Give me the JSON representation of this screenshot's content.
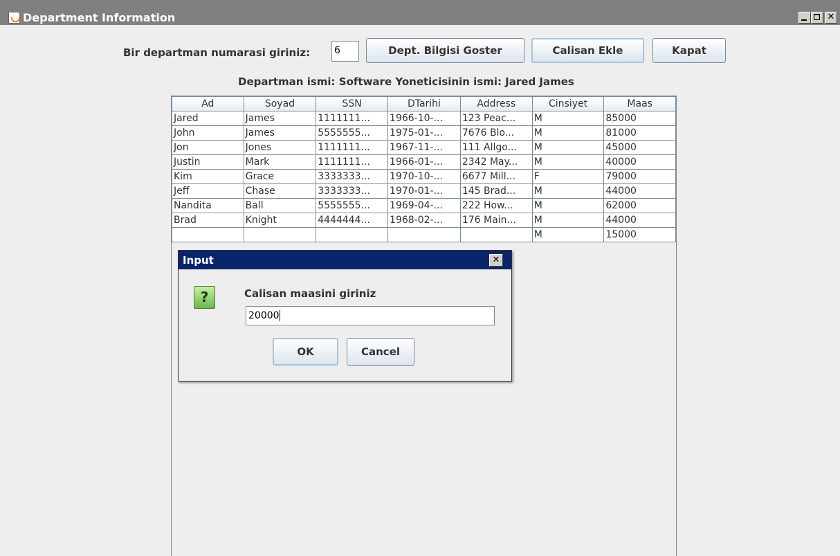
{
  "window": {
    "title": "Department Information",
    "minimize_glyph": "",
    "maximize_glyph": "",
    "close_glyph": "✕"
  },
  "form": {
    "prompt_label": "Bir departman numarasi giriniz:",
    "dept_number": "6",
    "show_button": "Dept. Bilgisi Goster",
    "add_button": "Calisan Ekle",
    "close_button": "Kapat",
    "info_label": "Departman ismi: Software Yoneticisinin ismi: Jared James"
  },
  "table": {
    "columns": [
      "Ad",
      "Soyad",
      "SSN",
      "DTarihi",
      "Address",
      "Cinsiyet",
      "Maas"
    ],
    "rows": [
      [
        "Jared",
        "James",
        "1111111...",
        "1966-10-...",
        "123 Peac...",
        "M",
        "85000"
      ],
      [
        "John",
        "James",
        "5555555...",
        "1975-01-...",
        "7676 Blo...",
        "M",
        "81000"
      ],
      [
        "Jon",
        "Jones",
        "1111111...",
        "1967-11-...",
        "111 Allgo...",
        "M",
        "45000"
      ],
      [
        "Justin",
        "Mark",
        "1111111...",
        "1966-01-...",
        "2342 May...",
        "M",
        "40000"
      ],
      [
        "Kim",
        "Grace",
        "3333333...",
        "1970-10-...",
        "6677 Mill...",
        "F",
        "79000"
      ],
      [
        "Jeff",
        "Chase",
        "3333333...",
        "1970-01-...",
        "145 Brad...",
        "M",
        "44000"
      ],
      [
        "Nandita",
        "Ball",
        "5555555...",
        "1969-04-...",
        "222 How...",
        "M",
        "62000"
      ],
      [
        "Brad",
        "Knight",
        "4444444...",
        "1968-02-...",
        "176 Main...",
        "M",
        "44000"
      ],
      [
        "",
        "",
        "",
        "",
        "",
        "M",
        "15000"
      ]
    ]
  },
  "dialog": {
    "title": "Input",
    "close_glyph": "✕",
    "icon_glyph": "?",
    "message": "Calisan maasini giriniz",
    "input_value": "20000",
    "ok_label": "OK",
    "cancel_label": "Cancel"
  }
}
